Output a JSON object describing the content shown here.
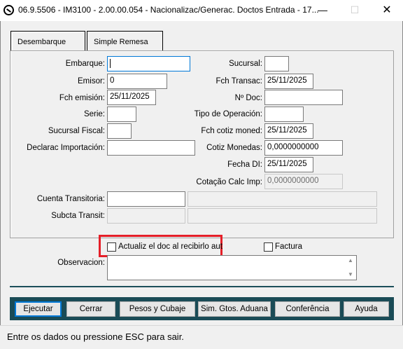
{
  "window": {
    "title": "06.9.5506 - IM3100 - 2.00.00.054 - Nacionalizac/Generac. Doctos Entrada - 17...",
    "minimize": "—",
    "maximize": "☐",
    "close": "✕"
  },
  "tabs": [
    {
      "label": "Desembarque",
      "active": true
    },
    {
      "label": "Simple Remesa",
      "active": false
    }
  ],
  "form_left": {
    "embarque_label": "Embarque:",
    "embarque_value": "",
    "emisor_label": "Emisor:",
    "emisor_value": "0",
    "fch_emision_label": "Fch emisión:",
    "fch_emision_value": "25/11/2025",
    "serie_label": "Serie:",
    "serie_value": "",
    "sucursal_fiscal_label": "Sucursal Fiscal:",
    "sucursal_fiscal_value": "",
    "declarac_label": "Declarac Importación:",
    "declarac_value": ""
  },
  "form_right": {
    "sucursal_label": "Sucursal:",
    "sucursal_value": "",
    "fch_transac_label": "Fch Transac:",
    "fch_transac_value": "25/11/2025",
    "nro_doc_label": "Nº Doc:",
    "nro_doc_value": "",
    "tipo_operacion_label": "Tipo de Operación:",
    "tipo_operacion_value": "",
    "fch_cotiz_label": "Fch cotiz moned:",
    "fch_cotiz_value": "25/11/2025",
    "cotiz_monedas_label": "Cotiz Monedas:",
    "cotiz_monedas_value": "0,0000000000",
    "fecha_di_label": "Fecha DI:",
    "fecha_di_value": "25/11/2025",
    "cotacao_label": "Cotação Calc Imp:",
    "cotacao_value": "0,0000000000"
  },
  "cuenta": {
    "cuenta_transitoria_label": "Cuenta Transitoria:",
    "cuenta_transitoria_value": "",
    "subcta_label": "Subcta Transit:"
  },
  "options": {
    "actualiz_label": "Actualiz el doc al recibirlo aut",
    "actualiz_checked": false,
    "factura_label": "Factura",
    "factura_checked": false
  },
  "observacion": {
    "label": "Observacion:",
    "value": ""
  },
  "buttons": {
    "ejecutar": "Ejecutar",
    "cerrar": "Cerrar",
    "pesos": "Pesos y Cubaje",
    "sim": "Sim. Gtos. Aduana",
    "conferencia": "Conferência",
    "ayuda": "Ayuda"
  },
  "status": "Entre os dados ou pressione ESC para sair.",
  "colors": {
    "accent": "#0078d7",
    "highlight": "#e51f28",
    "button_bar": "#1a4b56"
  }
}
